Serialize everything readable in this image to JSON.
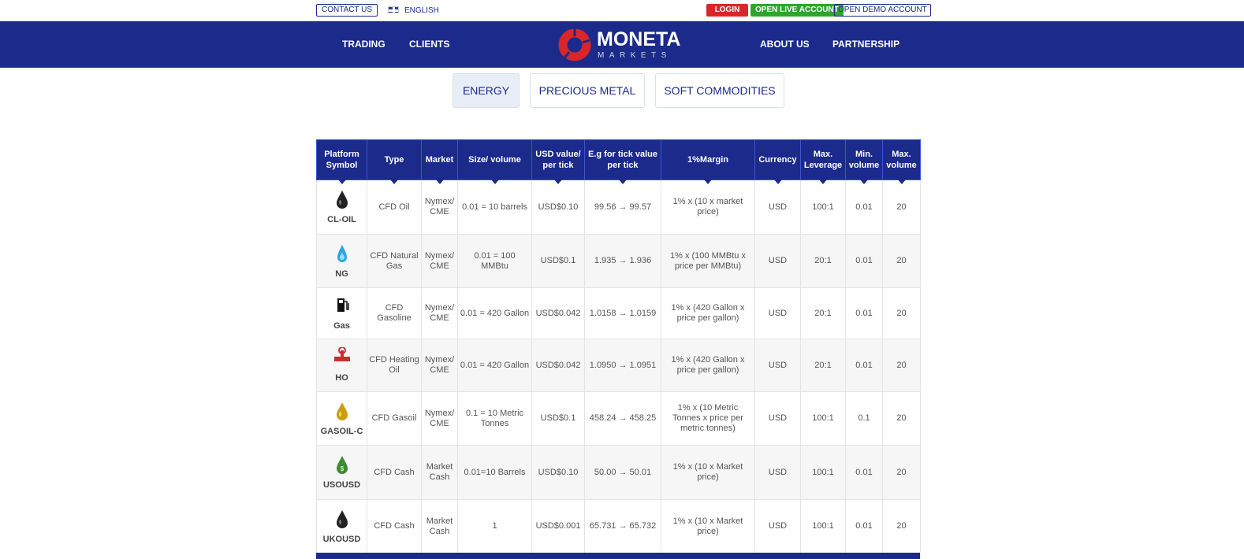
{
  "topbar": {
    "contact": "CONTACT US",
    "language": "ENGLISH",
    "login": "LOGIN",
    "live": "OPEN LIVE ACCOUNT",
    "demo": "OPEN DEMO ACCOUNT"
  },
  "nav": {
    "trading": "TRADING",
    "clients": "CLIENTS",
    "about": "ABOUT US",
    "partnership": "PARTNERSHIP",
    "logo_main": "MONETA",
    "logo_sub": "MARKETS"
  },
  "tabs": [
    "ENERGY",
    "PRECIOUS METAL",
    "SOFT COMMODITIES"
  ],
  "colors": {
    "brand": "#1b2a8b",
    "login": "#d9262a",
    "live": "#2fa52f"
  },
  "table": {
    "headers": [
      "Platform Symbol",
      "Type",
      "Market",
      "Size/ volume",
      "USD value/ per tick",
      "E.g for tick value per tick",
      "1%Margin",
      "Currency",
      "Max. Leverage",
      "Min. volume",
      "Max. volume"
    ],
    "rows": [
      {
        "icon": "black-oil-drop-icon",
        "symbol": "CL-OIL",
        "type": "CFD Oil",
        "market": "Nymex/ CME",
        "size": "0.01 = 10 barrels",
        "usd": "USD$0.10",
        "eg": "99.56 → 99.57",
        "margin": "1% x (10 x market price)",
        "currency": "USD",
        "lev": "100:1",
        "min": "0.01",
        "max": "20"
      },
      {
        "icon": "blue-gas-flame-icon",
        "symbol": "NG",
        "type": "CFD Natural Gas",
        "market": "Nymex/ CME",
        "size": "0.01 = 100 MMBtu",
        "usd": "USD$0.1",
        "eg": "1.935 → 1.936",
        "margin": "1% x (100 MMBtu x price per MMBtu)",
        "currency": "USD",
        "lev": "20:1",
        "min": "0.01",
        "max": "20"
      },
      {
        "icon": "fuel-pump-icon",
        "symbol": "Gas",
        "type": "CFD Gasoline",
        "market": "Nymex/ CME",
        "size": "0.01 = 420 Gallon",
        "usd": "USD$0.042",
        "eg": "1.0158 → 1.0159",
        "margin": "1% x (420 Gallon x price per gallon)",
        "currency": "USD",
        "lev": "20:1",
        "min": "0.01",
        "max": "20"
      },
      {
        "icon": "pipe-valve-icon",
        "symbol": "HO",
        "type": "CFD Heating Oil",
        "market": "Nymex/ CME",
        "size": "0.01 = 420 Gallon",
        "usd": "USD$0.042",
        "eg": "1.0950 → 1.0951",
        "margin": "1% x (420 Gallon x price per gallon)",
        "currency": "USD",
        "lev": "20:1",
        "min": "0.01",
        "max": "20"
      },
      {
        "icon": "gold-oil-drop-icon",
        "symbol": "GASOIL-C",
        "type": "CFD Gasoil",
        "market": "Nymex/ CME",
        "size": "0.1 = 10 Metric Tonnes",
        "usd": "USD$0.1",
        "eg": "458.24 → 458.25",
        "margin": "1% x (10 Metric Tonnes x price per metric tonnes)",
        "currency": "USD",
        "lev": "100:1",
        "min": "0.1",
        "max": "20"
      },
      {
        "icon": "green-dollar-drop-icon",
        "symbol": "USOUSD",
        "type": "CFD Cash",
        "market": "Market Cash",
        "size": "0.01=10 Barrels",
        "usd": "USD$0.10",
        "eg": "50.00 → 50.01",
        "margin": "1% x (10 x Market price)",
        "currency": "USD",
        "lev": "100:1",
        "min": "0.01",
        "max": "20"
      },
      {
        "icon": "black-oil-drop-icon",
        "symbol": "UKOUSD",
        "type": "CFD Cash",
        "market": "Market Cash",
        "size": "1",
        "usd": "USD$0.001",
        "eg": "65.731 → 65.732",
        "margin": "1% x (10 x Market price)",
        "currency": "USD",
        "lev": "100:1",
        "min": "0.01",
        "max": "20"
      }
    ]
  }
}
